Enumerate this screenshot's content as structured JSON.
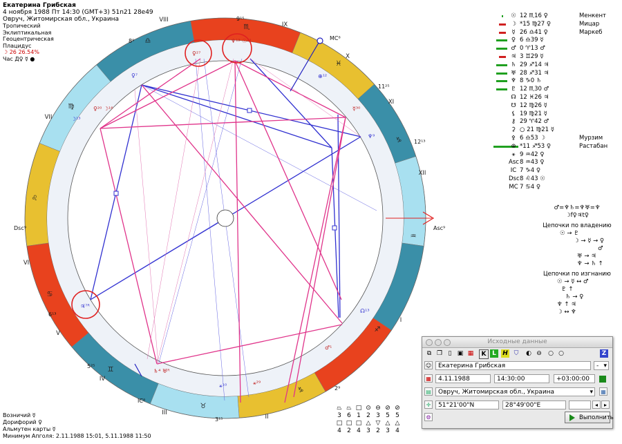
{
  "header": {
    "name": "Екатерина Грибская",
    "line1": "4 ноября 1988  Пт 14:30 (GMT+3) 51n21  28e49",
    "line2": "Овруч, Житомирская обл., Украина"
  },
  "settings": {
    "lines": [
      "Тропический",
      "Эклиптикальная",
      "Геоцентрическая",
      "Плацидус"
    ],
    "moon_phase": "☽ 26 26.54%",
    "hour": "Час Д♀ ☿ ●"
  },
  "wheel": {
    "house_labels": [
      "I",
      "II",
      "III",
      "IV",
      "V",
      "VI",
      "VII",
      "VIII",
      "IX",
      "X",
      "XI",
      "XII"
    ],
    "cusps": [
      {
        "label": "Asc9",
        "text": "Asc⁹"
      },
      {
        "label": "2",
        "text": "2⁹"
      },
      {
        "label": "3",
        "text": "3¹⁵"
      },
      {
        "label": "IC",
        "text": "IC⁸"
      },
      {
        "label": "5",
        "text": "5²⁵"
      },
      {
        "label": "6",
        "text": "6¹³"
      },
      {
        "label": "Dsc",
        "text": "Dsc⁹"
      },
      {
        "label": "8",
        "text": "8⁹"
      },
      {
        "label": "9",
        "text": "9¹⁵"
      },
      {
        "label": "MC",
        "text": "MC⁸"
      },
      {
        "label": "11",
        "text": "11²⁵"
      },
      {
        "label": "12",
        "text": "12¹³"
      }
    ],
    "signs": [
      "♏",
      "♐",
      "♑",
      "♒",
      "♓",
      "♈",
      "♉",
      "♊",
      "♋",
      "♌",
      "♍",
      "♎"
    ],
    "planet_marks": [
      "♀²⁷",
      "♆¹³ ☉¹²",
      "⊕¹²",
      "☿³⁰",
      "♆⁹",
      "♂¹",
      "☊¹³",
      "⚹²⁹",
      "⚹¹⁰",
      "♄⁴ ♅ᴿ",
      "♃⁷ᴿ",
      "☽¹³",
      "♀²⁰ ☽¹⁶",
      "♀⁷"
    ],
    "colors": {
      "red": "#e8421e",
      "yellow": "#e8c030",
      "teal": "#3a8fa8",
      "cyan": "#a8e0f0",
      "pink": "#e0338a",
      "blue": "#3030d0",
      "highlight": "#e02020"
    }
  },
  "planets": [
    {
      "bar": "small-green",
      "glyph": "☉",
      "pos": "12 ♏16",
      "sym": "♀",
      "star": "Менкент"
    },
    {
      "bar": "red",
      "glyph": "☽",
      "pos": "*15 ♍27",
      "sym": "♀",
      "star": "Мицар"
    },
    {
      "bar": "red",
      "glyph": "☿",
      "pos": "26 ♎41",
      "sym": "♀",
      "star": "Маркеб"
    },
    {
      "bar": "green",
      "glyph": "♀",
      "pos": "6 ♎39",
      "sym": "☿",
      "star": ""
    },
    {
      "bar": "green",
      "glyph": "♂",
      "pos": "0 ♈13",
      "sym": "♂",
      "star": ""
    },
    {
      "bar": "red",
      "glyph": "♃",
      "pos": "3 ♊29",
      "sym": "☿",
      "star": ""
    },
    {
      "bar": "green",
      "glyph": "♄",
      "pos": "29 ♐14",
      "sym": "♃",
      "star": ""
    },
    {
      "bar": "green",
      "glyph": "♅",
      "pos": "28 ♐31",
      "sym": "♃",
      "star": ""
    },
    {
      "bar": "green",
      "glyph": "♆",
      "pos": "8 ♑0",
      "sym": "♄",
      "star": ""
    },
    {
      "bar": "green",
      "glyph": "♇",
      "pos": "12 ♏30",
      "sym": "♂",
      "star": ""
    },
    {
      "bar": "",
      "glyph": "☊",
      "pos": "12 ♓26",
      "sym": "♃",
      "star": ""
    },
    {
      "bar": "",
      "glyph": "☋",
      "pos": "12 ♍26",
      "sym": "☿",
      "star": ""
    },
    {
      "bar": "",
      "glyph": "⚸",
      "pos": "19 ♍21",
      "sym": "☿",
      "star": ""
    },
    {
      "bar": "",
      "glyph": "⚷",
      "pos": "29 ♈42",
      "sym": "♂",
      "star": ""
    },
    {
      "bar": "",
      "glyph": "⚳",
      "pos": "○ 21 ♍21",
      "sym": "☿",
      "star": ""
    },
    {
      "bar": "",
      "glyph": "⚴",
      "pos": "6 ♎53",
      "sym": "☽",
      "star": "Мурзим"
    },
    {
      "bar": "long-green",
      "glyph": "⊕",
      "pos": "*11 ♐53",
      "sym": "♀",
      "star": "Растабан"
    },
    {
      "bar": "",
      "glyph": "⚹",
      "pos": "9 ♒42",
      "sym": "♀",
      "star": ""
    },
    {
      "bar": "",
      "glyph": "Asc",
      "pos": "8 ♒43",
      "sym": "♀",
      "star": ""
    },
    {
      "bar": "",
      "glyph": "IC",
      "pos": "7 ♑4",
      "sym": "♀",
      "star": ""
    },
    {
      "bar": "",
      "glyph": "Dsc",
      "pos": "8 ♌43",
      "sym": "☉",
      "star": ""
    },
    {
      "bar": "",
      "glyph": "MC",
      "pos": "7 ♋4",
      "sym": "♀",
      "star": ""
    }
  ],
  "formulas": {
    "line1": "♂=♆♄=♆♅=♆",
    "line2": "☽f♀♃t♀",
    "own_title": "Цепочки по владению",
    "own_rows": [
      "☉ → ♇",
      "☽ → ☿ → ♀",
      "♂",
      "♅ → ♃",
      "♆ → ♄ ↑"
    ],
    "exile_title": "Цепочки по изгнанию",
    "exile_rows": [
      "☉ → ☿ ↔ ♂",
      "♇ ↑",
      "♄ → ♀",
      "♆ ↑  ♃",
      "☽ ↔ ♆"
    ]
  },
  "bottom_left": {
    "lines": [
      "Возничий ☿",
      "Дорифорий ♀",
      "Альмутен карты ☿",
      "Минимум Апголя: 2.11.1988 15:01,  5.11.1988 11:50"
    ]
  },
  "shapes": {
    "row1_symbols": [
      "⏢",
      "⏢",
      "□",
      "⊙",
      "⊖",
      "⊘"
    ],
    "row1_nums": [
      "3",
      "6",
      "1",
      "2",
      "3",
      "5"
    ],
    "row2_symbols": [
      "□",
      "□",
      "□",
      "△",
      "▽",
      "△"
    ],
    "row2_nums": [
      "4",
      "2",
      "4",
      "3",
      "2",
      "3"
    ],
    "extra_symbols": [
      "⊘",
      "△"
    ],
    "extra_nums": [
      "5",
      "4"
    ]
  },
  "dialog": {
    "title": "Исходные данные",
    "name_value": "Екатерина Грибская",
    "gender_value": "-",
    "date_value": "4.11.1988",
    "time_value": "14:30:00",
    "tz_value": "+03:00:00",
    "place_value": "Овруч, Житомирская обл., Украина",
    "lat_value": "51°21'00\"N",
    "lon_value": "28°49'00\"E",
    "run_label": "Выполнить"
  }
}
